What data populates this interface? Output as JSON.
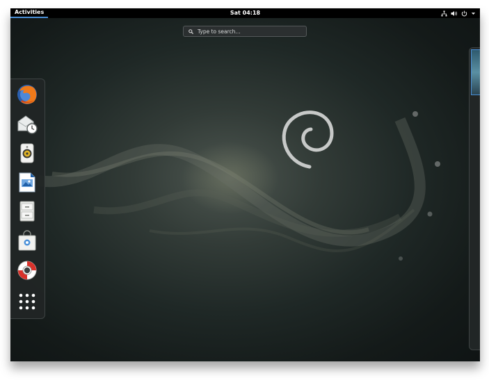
{
  "topbar": {
    "activities_label": "Activities",
    "clock": "Sat 04:18",
    "status_icons": [
      "network-icon",
      "volume-icon",
      "power-icon",
      "chevron-down-icon"
    ]
  },
  "search": {
    "placeholder": "Type to search..."
  },
  "dash": {
    "items": [
      {
        "name": "Firefox",
        "icon": "firefox-icon"
      },
      {
        "name": "Evolution",
        "icon": "mail-clock-icon"
      },
      {
        "name": "Rhythmbox",
        "icon": "speaker-icon"
      },
      {
        "name": "LibreOffice Writer",
        "icon": "document-icon"
      },
      {
        "name": "Files",
        "icon": "file-cabinet-icon"
      },
      {
        "name": "Software",
        "icon": "shopping-bag-icon"
      },
      {
        "name": "Help",
        "icon": "lifebuoy-icon"
      },
      {
        "name": "Show Applications",
        "icon": "app-grid-icon"
      }
    ]
  },
  "wallpaper": {
    "logo": "debian-swirl-logo"
  },
  "colors": {
    "topbar_bg": "#000000",
    "accent": "#4a90d9",
    "dash_bg": "#212525"
  }
}
